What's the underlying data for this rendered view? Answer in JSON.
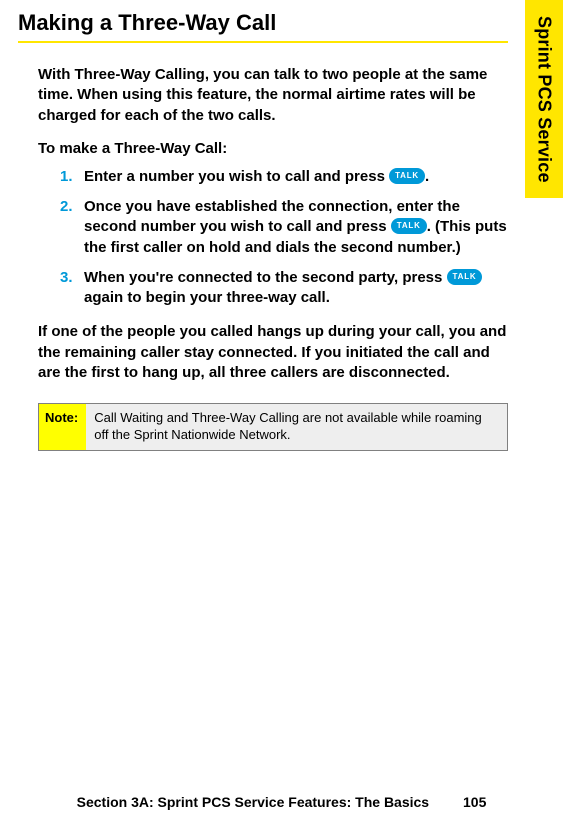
{
  "sideTab": "Sprint PCS Service",
  "heading": "Making a Three-Way Call",
  "intro": "With Three-Way Calling, you can talk to two people at the same time. When using this feature, the normal airtime rates will be charged for each of the two calls.",
  "subHeading": "To make a Three-Way Call:",
  "steps": [
    {
      "num": "1.",
      "pre": "Enter a number you wish to call and press ",
      "btn": "TALK",
      "post": "."
    },
    {
      "num": "2.",
      "pre": "Once you have established the connection, enter the second number you wish to call and press ",
      "btn": "TALK",
      "post": ". (This puts the first caller on hold and dials the second number.)"
    },
    {
      "num": "3.",
      "pre": "When you're connected to the second party, press ",
      "btn": "TALK",
      "post": " again to begin your three-way call."
    }
  ],
  "outro": "If one of the people you called hangs up during your call, you and the remaining caller stay connected. If you initiated the call and are the first to hang up, all three callers are disconnected.",
  "note": {
    "label": "Note:",
    "body": "Call Waiting and Three-Way Calling are not available while roaming off the Sprint Nationwide Network."
  },
  "footer": {
    "section": "Section 3A: Sprint PCS Service Features: The Basics",
    "page": "105"
  }
}
